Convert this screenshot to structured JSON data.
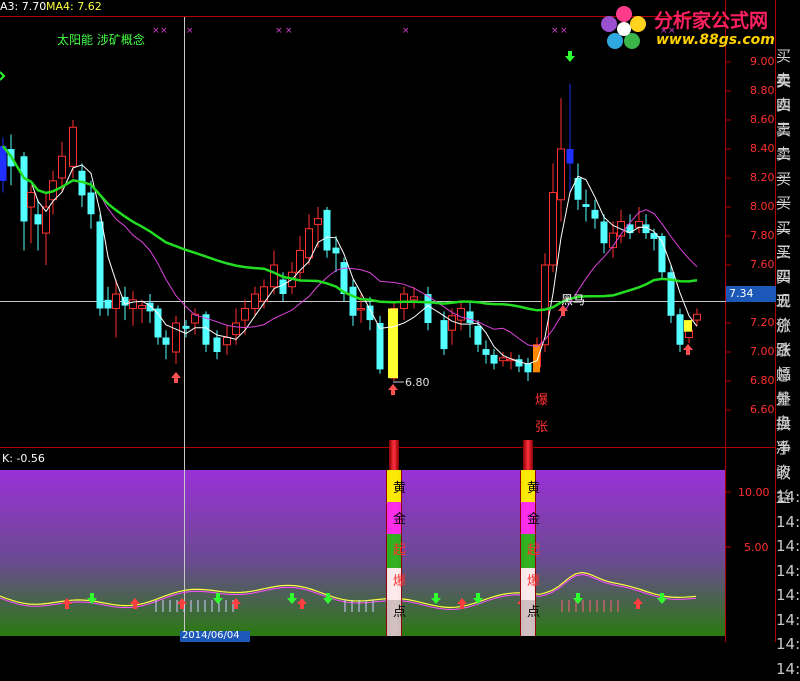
{
  "header": {
    "ma3": "A3: 7.70",
    "ma4": "MA4: 7.62",
    "concepts": "太阳能 涉矿概念"
  },
  "price_axis": {
    "ticks": [
      "9.00",
      "8.80",
      "8.60",
      "8.40",
      "8.20",
      "8.00",
      "7.80",
      "7.60",
      "7.40",
      "7.20",
      "7.00",
      "6.80",
      "6.60"
    ],
    "current_price": "7.34"
  },
  "annotations": {
    "low_price": "6.80",
    "black_horse": "黑马",
    "burst_1": "爆",
    "burst_2": "张"
  },
  "indicator": {
    "label": "K: -0.56",
    "ticks": [
      "10.00",
      "5.00"
    ],
    "date_label": "2014/06/04",
    "pillar_chars": [
      "黄",
      "金",
      "起",
      "爆",
      "点"
    ]
  },
  "side_panel": {
    "labels": [
      "买卖",
      "卖四",
      "卖三",
      "卖二",
      "卖一",
      "买一",
      "买二",
      "买三",
      "买四",
      "买五",
      "现价",
      "涨跌",
      "涨幅",
      "总量",
      "外盘",
      "换手",
      "净资",
      "收益",
      "14:",
      "14:",
      "14:",
      "14:",
      "14:",
      "14:",
      "14:",
      "14:"
    ]
  },
  "watermark": {
    "title": "分析家公式网",
    "url": "www.88gs.com"
  },
  "colors": {
    "up_candle": "#ff3030",
    "down_candle": "#54ffff",
    "ma_slow": "#22dd22",
    "ma_mid": "#dd44dd",
    "ma_fast": "#ffffff",
    "axis_red": "#b00000",
    "panel_purple": "#9a30d8",
    "panel_green": "#2a7a10"
  }
}
